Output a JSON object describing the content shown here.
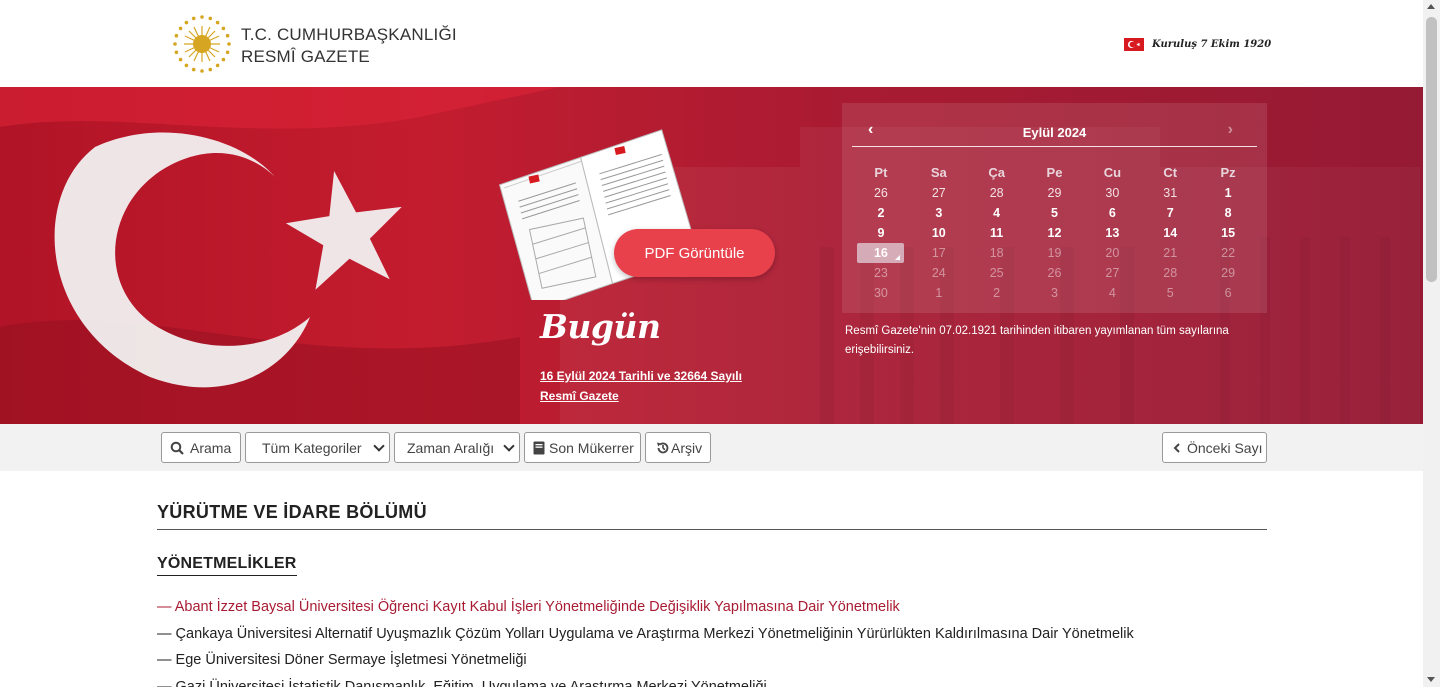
{
  "header": {
    "brand_line1": "T.C. CUMHURBAŞKANLIĞI",
    "brand_line2": "RESMÎ GAZETE",
    "founded": "Kuruluş 7 Ekim 1920"
  },
  "hero": {
    "pdf_button": "PDF Görüntüle",
    "today_heading": "Bugün",
    "today_link": "16 Eylül 2024 Tarihli ve 32664 Sayılı Resmî Gazete",
    "archive_note": "Resmî Gazete'nin 07.02.1921 tarihinden itibaren yayımlanan tüm sayılarına erişebilirsiniz."
  },
  "calendar": {
    "title": "Eylül 2024",
    "prev": "‹",
    "next": "›",
    "weekdays": [
      "Pt",
      "Sa",
      "Ça",
      "Pe",
      "Cu",
      "Ct",
      "Pz"
    ],
    "weeks": [
      [
        "26",
        "27",
        "28",
        "29",
        "30",
        "31",
        "1"
      ],
      [
        "2",
        "3",
        "4",
        "5",
        "6",
        "7",
        "8"
      ],
      [
        "9",
        "10",
        "11",
        "12",
        "13",
        "14",
        "15"
      ],
      [
        "16",
        "17",
        "18",
        "19",
        "20",
        "21",
        "22"
      ],
      [
        "23",
        "24",
        "25",
        "26",
        "27",
        "28",
        "29"
      ],
      [
        "30",
        "1",
        "2",
        "3",
        "4",
        "5",
        "6"
      ]
    ],
    "selected": "16"
  },
  "toolbar": {
    "search": "Arama",
    "category": "Tüm Kategoriler",
    "range": "Zaman Aralığı",
    "repeat": "Son Mükerrer",
    "archive": "Arşiv",
    "previous": "Önceki Sayı"
  },
  "content": {
    "section_title": "YÜRÜTME VE İDARE BÖLÜMÜ",
    "sub_title": "YÖNETMELİKLER",
    "items": [
      "— Abant İzzet Baysal Üniversitesi Öğrenci Kayıt Kabul İşleri Yönetmeliğinde Değişiklik Yapılmasına Dair Yönetmelik",
      "— Çankaya Üniversitesi Alternatif Uyuşmazlık Çözüm Yolları Uygulama ve Araştırma Merkezi Yönetmeliğinin Yürürlükten Kaldırılmasına Dair Yönetmelik",
      "— Ege Üniversitesi Döner Sermaye İşletmesi Yönetmeliği",
      "— Gazi Üniversitesi İstatistik Danışmanlık, Eğitim, Uygulama ve Araştırma Merkezi Yönetmeliği"
    ]
  },
  "colors": {
    "hero_red": "#b01426",
    "pdf_button": "#e8414c",
    "link_red": "#a81c33"
  },
  "icons": {
    "search": "search-icon",
    "book": "book-icon",
    "history": "history-icon",
    "chevron_left": "chevron-left-icon"
  }
}
